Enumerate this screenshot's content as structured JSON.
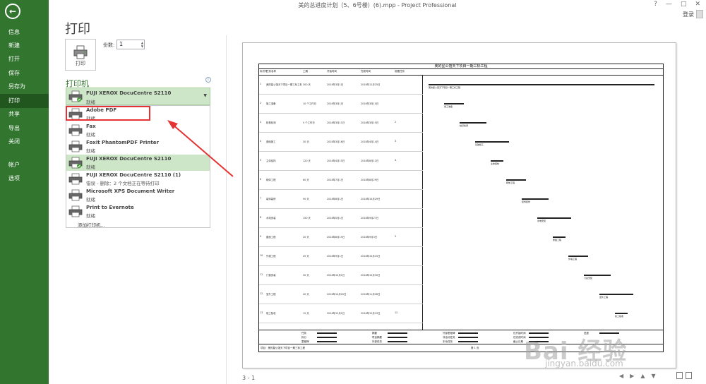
{
  "window": {
    "title": "美的总进度计划（5、6号楼）(6).mpp - Project Professional",
    "controls": [
      "?",
      "—",
      "□",
      "✕"
    ],
    "user": "登录"
  },
  "sidebar": {
    "items": [
      {
        "label": "信息",
        "active": false
      },
      {
        "label": "新建",
        "active": false
      },
      {
        "label": "打开",
        "active": false
      },
      {
        "label": "保存",
        "active": false
      },
      {
        "label": "另存为",
        "active": false
      },
      {
        "label": "打印",
        "active": true
      },
      {
        "label": "共享",
        "active": false
      },
      {
        "label": "导出",
        "active": false
      },
      {
        "label": "关闭",
        "active": false
      },
      {
        "label": "帐户",
        "active": false
      },
      {
        "label": "选项",
        "active": false
      }
    ]
  },
  "print": {
    "title": "打印",
    "button_label": "打印",
    "copies_label": "份数:",
    "copies_value": "1",
    "printer_section": "打印机",
    "info_icon": "i",
    "current_printer": {
      "name": "FUJI XEROX DocuCentre S2110",
      "status": "就绪"
    },
    "printers": [
      {
        "name": "Adobe PDF",
        "status": "就绪",
        "selected": false,
        "highlight": true
      },
      {
        "name": "Fax",
        "status": "就绪",
        "selected": false,
        "highlight": false
      },
      {
        "name": "Foxit PhantomPDF Printer",
        "status": "就绪",
        "selected": false,
        "highlight": false
      },
      {
        "name": "FUJI XEROX DocuCentre S2110",
        "status": "就绪",
        "selected": true,
        "highlight": false
      },
      {
        "name": "FUJI XEROX DocuCentre S2110 (1)",
        "status": "错误 - 删除：2 个文档正在等待打印",
        "selected": false,
        "highlight": false
      },
      {
        "name": "Microsoft XPS Document Writer",
        "status": "就绪",
        "selected": false,
        "highlight": false
      },
      {
        "name": "Print to Evernote",
        "status": "就绪",
        "selected": false,
        "highlight": false
      }
    ],
    "add_printer": "添加打印机..."
  },
  "preview": {
    "doc_title": "美的星公馆天下项目一期三标工程",
    "columns": [
      "标识号",
      "任务名称",
      "工期",
      "开始时间",
      "完成时间",
      "前置任务"
    ],
    "rows": [
      [
        "1",
        "美的星公馆天下项目一期三标工程",
        "300 天",
        "2018年3月1日",
        "2018年12月25日",
        ""
      ],
      [
        "2",
        "施工准备",
        "10 个工作日",
        "2018年3月1日",
        "2018年3月10日",
        ""
      ],
      [
        "3",
        "桩基检测",
        "5 个工作日",
        "2018年3月11日",
        "2018年3月15日",
        "2"
      ],
      [
        "4",
        "基础施工",
        "30 天",
        "2018年3月16日",
        "2018年4月14日",
        "3"
      ],
      [
        "5",
        "主体结构",
        "120 天",
        "2018年4月15日",
        "2018年8月12日",
        "4"
      ],
      [
        "6",
        "砌体工程",
        "60 天",
        "2018年7月1日",
        "2018年8月29日",
        ""
      ],
      [
        "7",
        "装饰装修",
        "90 天",
        "2018年8月1日",
        "2018年10月29日",
        ""
      ],
      [
        "8",
        "水电安装",
        "150 天",
        "2018年5月1日",
        "2018年9月27日",
        ""
      ],
      [
        "9",
        "屋面工程",
        "20 天",
        "2018年8月15日",
        "2018年9月3日",
        "5"
      ],
      [
        "10",
        "外墙工程",
        "45 天",
        "2018年9月1日",
        "2018年10月15日",
        ""
      ],
      [
        "11",
        "门窗安装",
        "30 天",
        "2018年10月1日",
        "2018年10月30日",
        ""
      ],
      [
        "12",
        "室外工程",
        "40 天",
        "2018年10月20日",
        "2018年11月28日",
        ""
      ],
      [
        "13",
        "竣工验收",
        "15 天",
        "2018年12月1日",
        "2018年12月15日",
        "12"
      ]
    ],
    "legend": [
      "任务",
      "拆分",
      "里程碑",
      "摘要",
      "项目摘要",
      "外部任务",
      "外部里程碑",
      "非活动任务",
      "手动任务",
      "仅开始时间",
      "仅完成时间",
      "截止日期",
      "进度"
    ],
    "footer": "项目：美的星公馆天下项目一期三标工程",
    "page_label": "第 1 页"
  },
  "status": {
    "page_indicator": "3 - 1"
  },
  "watermark": {
    "logo": "Bai 经验",
    "url": "jingyan.baidu.com"
  }
}
